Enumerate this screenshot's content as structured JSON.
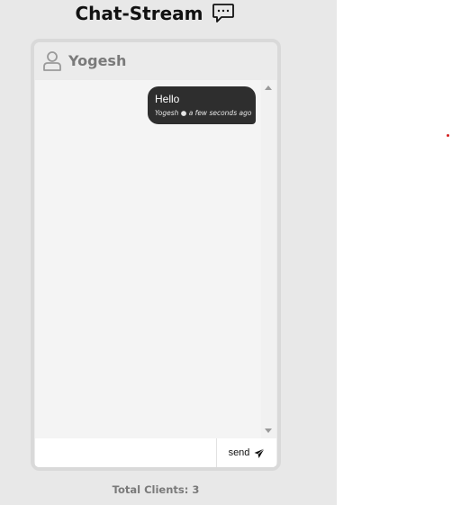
{
  "app": {
    "title": "Chat-Stream",
    "title_icon": "chat-bubble-icon"
  },
  "chat": {
    "username": "Yogesh",
    "user_icon": "user-icon",
    "messages": [
      {
        "text": "Hello",
        "meta": "Yogesh ● a few seconds ago"
      }
    ]
  },
  "composer": {
    "input_value": "",
    "placeholder": "",
    "send_label": "send",
    "send_icon": "paper-plane-icon"
  },
  "footer": {
    "total_clients": "Total Clients: 3"
  },
  "colors": {
    "panel_background": "#e8e8e8",
    "message_bubble": "#2e2e2e",
    "muted_text": "#7a7a7a"
  }
}
